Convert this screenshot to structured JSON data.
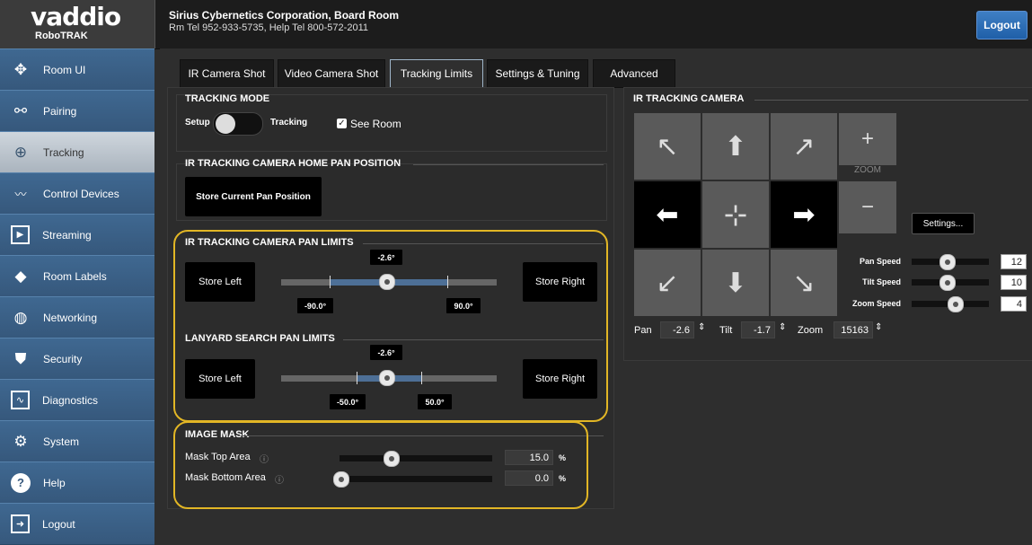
{
  "header": {
    "brand": "vaddio",
    "product": "RoboTRAK",
    "title": "Sirius Cybernetics Corporation, Board Room",
    "subtitle": "Rm Tel 952-933-5735, Help Tel 800-572-2011",
    "logout_label": "Logout"
  },
  "sidebar": {
    "items": [
      {
        "label": "Room UI",
        "icon": "move-arrows-icon"
      },
      {
        "label": "Pairing",
        "icon": "link-icon"
      },
      {
        "label": "Tracking",
        "icon": "target-icon"
      },
      {
        "label": "Control Devices",
        "icon": "signal-icon"
      },
      {
        "label": "Streaming",
        "icon": "play-icon"
      },
      {
        "label": "Room Labels",
        "icon": "tag-icon"
      },
      {
        "label": "Networking",
        "icon": "globe-icon"
      },
      {
        "label": "Security",
        "icon": "shield-icon"
      },
      {
        "label": "Diagnostics",
        "icon": "pulse-icon"
      },
      {
        "label": "System",
        "icon": "gear-icon"
      },
      {
        "label": "Help",
        "icon": "help-icon"
      },
      {
        "label": "Logout",
        "icon": "logout-icon"
      }
    ]
  },
  "tabs": [
    "IR Camera Shot",
    "Video Camera Shot",
    "Tracking Limits",
    "Settings & Tuning",
    "Advanced"
  ],
  "tracking_mode": {
    "title": "TRACKING MODE",
    "setup_label": "Setup",
    "tracking_label": "Tracking",
    "see_room_label": "See Room",
    "see_room_checked": true
  },
  "home_pan": {
    "title": "IR TRACKING CAMERA HOME PAN POSITION",
    "button_label": "Store Current Pan Position"
  },
  "pan_limits": {
    "title": "IR TRACKING CAMERA PAN LIMITS",
    "store_left": "Store Left",
    "store_right": "Store Right",
    "current": "-2.6°",
    "left_limit": "-90.0°",
    "right_limit": "90.0°"
  },
  "lanyard_limits": {
    "title": "LANYARD SEARCH PAN LIMITS",
    "store_left": "Store Left",
    "store_right": "Store Right",
    "current": "-2.6°",
    "left_limit": "-50.0°",
    "right_limit": "50.0°"
  },
  "image_mask": {
    "title": "IMAGE MASK",
    "top_label": "Mask Top Area",
    "top_value": "15.0",
    "bottom_label": "Mask Bottom Area",
    "bottom_value": "0.0",
    "unit": "%",
    "top_fraction": 0.15,
    "bottom_fraction": 0.0
  },
  "ir_camera": {
    "title": "IR TRACKING CAMERA",
    "zoom_label": "ZOOM",
    "settings_label": "Settings...",
    "pan_speed_label": "Pan Speed",
    "pan_speed": "12",
    "tilt_speed_label": "Tilt Speed",
    "tilt_speed": "10",
    "zoom_speed_label": "Zoom Speed",
    "zoom_speed": "4",
    "pan_label": "Pan",
    "pan_value": "-2.6",
    "tilt_label": "Tilt",
    "tilt_value": "-1.7",
    "zoom_pos_label": "Zoom",
    "zoom_value": "15163"
  },
  "colors": {
    "accent": "#4d6f96",
    "highlight": "#e2b625",
    "logout": "#2f6db5"
  }
}
